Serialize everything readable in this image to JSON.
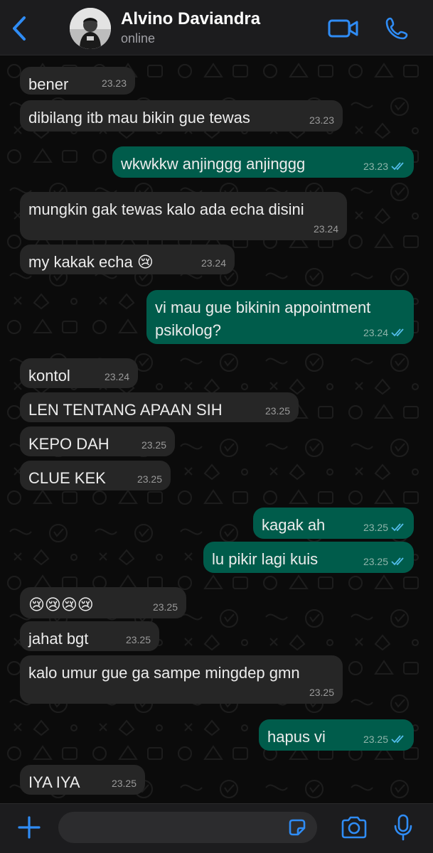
{
  "header": {
    "contact_name": "Alvino Daviandra",
    "status": "online",
    "accent_color": "#2f8cf5"
  },
  "messages": [
    {
      "dir": "in",
      "text": "bener",
      "time": "23.23"
    },
    {
      "dir": "in",
      "text": "dibilang itb mau bikin gue tewas",
      "time": "23.23"
    },
    {
      "dir": "out",
      "text": "wkwkkw anjinggg anjinggg",
      "time": "23.23",
      "read": true
    },
    {
      "dir": "in",
      "text": "mungkin gak tewas kalo ada echa disini",
      "time": "23.24"
    },
    {
      "dir": "in",
      "text": "my kakak echa 😢",
      "time": "23.24"
    },
    {
      "dir": "out",
      "text": "vi mau gue bikinin appointment\npsikolog?",
      "time": "23.24",
      "read": true
    },
    {
      "dir": "in",
      "text": "kontol",
      "time": "23.24"
    },
    {
      "dir": "in",
      "text": "LEN TENTANG APAAN SIH",
      "time": "23.25"
    },
    {
      "dir": "in",
      "text": "KEPO DAH",
      "time": "23.25"
    },
    {
      "dir": "in",
      "text": "CLUE KEK",
      "time": "23.25"
    },
    {
      "dir": "out",
      "text": "kagak ah",
      "time": "23.25",
      "read": true
    },
    {
      "dir": "out",
      "text": "lu pikir lagi kuis",
      "time": "23.25",
      "read": true
    },
    {
      "dir": "in",
      "text": "😢😢😢😢",
      "time": "23.25"
    },
    {
      "dir": "in",
      "text": "jahat bgt",
      "time": "23.25"
    },
    {
      "dir": "in",
      "text": "kalo umur gue ga sampe mingdep gmn",
      "time": "23.25"
    },
    {
      "dir": "out",
      "text": "hapus vi",
      "time": "23.25",
      "read": true
    },
    {
      "dir": "in",
      "text": "IYA IYA",
      "time": "23.25"
    }
  ],
  "composer": {
    "placeholder": "",
    "value": ""
  },
  "icons": {
    "back": "chevron-left-icon",
    "video": "video-call-icon",
    "call": "phone-icon",
    "attach": "plus-icon",
    "sticker": "sticker-icon",
    "camera": "camera-icon",
    "mic": "microphone-icon"
  },
  "colors": {
    "incoming_bubble": "#262626",
    "outgoing_bubble": "#005c4b",
    "read_ticks": "#53bdeb",
    "background": "#0b0b0b"
  }
}
